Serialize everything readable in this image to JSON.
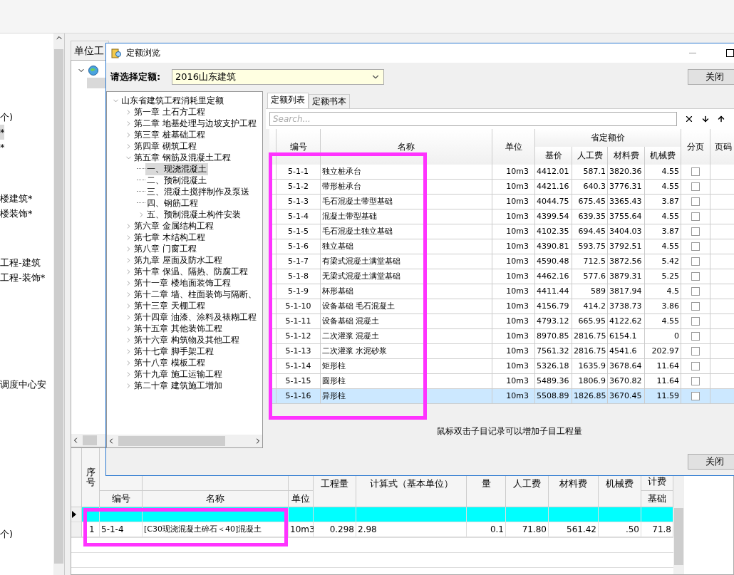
{
  "left_panel": {
    "groups": [
      {
        "items": [
          {
            "label": "个)",
            "selected": false
          },
          {
            "label": "*",
            "selected": true
          },
          {
            "label": "*",
            "selected": false
          }
        ]
      },
      {
        "items": [
          {
            "label": "楼建筑*",
            "selected": false
          },
          {
            "label": "楼装饰*",
            "selected": false
          }
        ]
      },
      {
        "items": [
          {
            "label": "工程-建筑",
            "selected": false
          },
          {
            "label": "工程-装饰*",
            "selected": false
          }
        ]
      },
      {
        "items": [
          {
            "label": "调度中心安",
            "selected": false
          }
        ]
      },
      {
        "items": [
          {
            "label": "个)",
            "selected": false
          }
        ]
      }
    ]
  },
  "unit_panel": {
    "tab": "单位工"
  },
  "bottom_grid": {
    "columns": [
      {
        "label": "序号",
        "kind": "vertical"
      },
      {
        "label": "编号",
        "kind": "sub"
      },
      {
        "label": "名称",
        "kind": "sub"
      },
      {
        "label": "单位",
        "kind": "sub"
      },
      {
        "label": "工程量",
        "kind": "tall"
      },
      {
        "label": "计算式（基本单位）",
        "kind": "tall"
      },
      {
        "label": "量",
        "kind": "tall"
      },
      {
        "label": "人工费",
        "kind": "tall"
      },
      {
        "label": "材料费",
        "kind": "tall"
      },
      {
        "label": "机械费",
        "kind": "tall"
      },
      {
        "label": "基础",
        "group": "计费",
        "kind": "grouped"
      }
    ],
    "rows": [
      {
        "kind": "blank",
        "current": true
      },
      {
        "kind": "data",
        "current": false,
        "cells": [
          "1",
          "5-1-4",
          "[C30现浇混凝土碎石＜40]混凝土",
          "10m3",
          "0.298",
          "2.98",
          "0.1",
          "71.80",
          "561.42",
          ".50",
          "71.8"
        ]
      }
    ]
  },
  "dialog": {
    "title": "定额浏览",
    "select_label": "请选择定额:",
    "select_value": "2016山东建筑",
    "close_button": "关闭",
    "bottom_close_button": "关闭",
    "tree": [
      {
        "label": "山东省建筑工程消耗里定额",
        "expandable": true,
        "expanded": true,
        "selected": false,
        "children": [
          {
            "label": "第一章 土石方工程",
            "expandable": true,
            "expanded": false,
            "selected": false
          },
          {
            "label": "第二章 地基处理与边坡支护工程",
            "expandable": true,
            "expanded": false,
            "selected": false
          },
          {
            "label": "第三章 桩基础工程",
            "expandable": true,
            "expanded": false,
            "selected": false
          },
          {
            "label": "第四章 砌筑工程",
            "expandable": true,
            "expanded": false,
            "selected": false
          },
          {
            "label": "第五章 钢筋及混凝土工程",
            "expandable": true,
            "expanded": true,
            "selected": false,
            "children": [
              {
                "label": "一、现浇混凝土",
                "expandable": false,
                "selected": true
              },
              {
                "label": "二、预制混凝土",
                "expandable": false,
                "selected": false
              },
              {
                "label": "三、混凝土搅拌制作及泵送",
                "expandable": false,
                "selected": false
              },
              {
                "label": "四、钢筋工程",
                "expandable": false,
                "selected": false
              },
              {
                "label": "五、预制混凝土构件安装",
                "expandable": true,
                "expanded": false,
                "selected": false
              }
            ]
          },
          {
            "label": "第六章 金属结构工程",
            "expandable": true,
            "expanded": false,
            "selected": false
          },
          {
            "label": "第七章 木结构工程",
            "expandable": true,
            "expanded": false,
            "selected": false
          },
          {
            "label": "第八章 门窗工程",
            "expandable": true,
            "expanded": false,
            "selected": false
          },
          {
            "label": "第九章 屋面及防水工程",
            "expandable": true,
            "expanded": false,
            "selected": false
          },
          {
            "label": "第十章 保温、隔热、防腐工程",
            "expandable": true,
            "expanded": false,
            "selected": false
          },
          {
            "label": "第十一章 楼地面装饰工程",
            "expandable": true,
            "expanded": false,
            "selected": false
          },
          {
            "label": "第十二章 墙、柱面装饰与隔断、",
            "expandable": true,
            "expanded": false,
            "selected": false
          },
          {
            "label": "第十三章 天棚工程",
            "expandable": true,
            "expanded": false,
            "selected": false
          },
          {
            "label": "第十四章 油漆、涂料及裱糊工程",
            "expandable": true,
            "expanded": false,
            "selected": false
          },
          {
            "label": "第十五章 其他装饰工程",
            "expandable": true,
            "expanded": false,
            "selected": false
          },
          {
            "label": "第十六章 构筑物及其他工程",
            "expandable": true,
            "expanded": false,
            "selected": false
          },
          {
            "label": "第十七章 脚手架工程",
            "expandable": true,
            "expanded": false,
            "selected": false
          },
          {
            "label": "第十八章 模板工程",
            "expandable": true,
            "expanded": false,
            "selected": false
          },
          {
            "label": "第十九章 施工运输工程",
            "expandable": true,
            "expanded": false,
            "selected": false
          },
          {
            "label": "第二十章 建筑施工增加",
            "expandable": true,
            "expanded": false,
            "selected": false
          }
        ]
      }
    ],
    "tabs": [
      {
        "label": "定额列表",
        "selected": true
      },
      {
        "label": "定额书本",
        "selected": false
      }
    ],
    "search": {
      "placeholder": "Search..."
    },
    "table": {
      "columns": [
        {
          "label": "编号"
        },
        {
          "label": "名称"
        },
        {
          "label": "单位"
        },
        {
          "group": "省定额价",
          "children": [
            "基价",
            "人工费",
            "材料费",
            "机械费"
          ]
        },
        {
          "label": "分页"
        },
        {
          "label": "页码"
        }
      ],
      "rows": [
        {
          "code": "5-1-1",
          "name": "独立桩承台",
          "unit": "10m3",
          "base": "4412.01",
          "labor": "587.1",
          "material": "3820.36",
          "machine": "4.55",
          "paged": false,
          "selected": false
        },
        {
          "code": "5-1-2",
          "name": "带形桩承台",
          "unit": "10m3",
          "base": "4421.16",
          "labor": "640.3",
          "material": "3776.31",
          "machine": "4.55",
          "paged": false,
          "selected": false
        },
        {
          "code": "5-1-3",
          "name": "毛石混凝土带型基础",
          "unit": "10m3",
          "base": "4044.75",
          "labor": "675.45",
          "material": "3365.43",
          "machine": "3.87",
          "paged": false,
          "selected": false
        },
        {
          "code": "5-1-4",
          "name": "混凝土带型基础",
          "unit": "10m3",
          "base": "4399.54",
          "labor": "639.35",
          "material": "3755.64",
          "machine": "4.55",
          "paged": false,
          "selected": false
        },
        {
          "code": "5-1-5",
          "name": "毛石混凝土独立基础",
          "unit": "10m3",
          "base": "4102.35",
          "labor": "694.45",
          "material": "3404.03",
          "machine": "3.87",
          "paged": false,
          "selected": false
        },
        {
          "code": "5-1-6",
          "name": "独立基础",
          "unit": "10m3",
          "base": "4390.81",
          "labor": "593.75",
          "material": "3792.51",
          "machine": "4.55",
          "paged": false,
          "selected": false
        },
        {
          "code": "5-1-7",
          "name": "有梁式混凝土满堂基础",
          "unit": "10m3",
          "base": "4590.48",
          "labor": "712.5",
          "material": "3872.56",
          "machine": "5.42",
          "paged": false,
          "selected": false
        },
        {
          "code": "5-1-8",
          "name": "无梁式混凝土满堂基础",
          "unit": "10m3",
          "base": "4462.16",
          "labor": "577.6",
          "material": "3879.31",
          "machine": "5.25",
          "paged": false,
          "selected": false
        },
        {
          "code": "5-1-9",
          "name": "杯形基础",
          "unit": "10m3",
          "base": "4411.44",
          "labor": "589",
          "material": "3817.94",
          "machine": "4.5",
          "paged": false,
          "selected": false
        },
        {
          "code": "5-1-10",
          "name": "设备基础 毛石混凝土",
          "unit": "10m3",
          "base": "4156.79",
          "labor": "414.2",
          "material": "3738.73",
          "machine": "3.86",
          "paged": false,
          "selected": false
        },
        {
          "code": "5-1-11",
          "name": "设备基础 混凝土",
          "unit": "10m3",
          "base": "4793.12",
          "labor": "665.95",
          "material": "4122.62",
          "machine": "4.55",
          "paged": false,
          "selected": false
        },
        {
          "code": "5-1-12",
          "name": "二次灌浆 混凝土",
          "unit": "10m3",
          "base": "8970.85",
          "labor": "2816.75",
          "material": "6154.1",
          "machine": "0",
          "paged": false,
          "selected": false
        },
        {
          "code": "5-1-13",
          "name": "二次灌浆 水泥砂浆",
          "unit": "10m3",
          "base": "7561.32",
          "labor": "2816.75",
          "material": "4541.6",
          "machine": "202.97",
          "paged": false,
          "selected": false
        },
        {
          "code": "5-1-14",
          "name": "矩形柱",
          "unit": "10m3",
          "base": "5326.18",
          "labor": "1635.9",
          "material": "3678.64",
          "machine": "11.64",
          "paged": false,
          "selected": false
        },
        {
          "code": "5-1-15",
          "name": "圆形柱",
          "unit": "10m3",
          "base": "5489.36",
          "labor": "1806.9",
          "material": "3670.82",
          "machine": "11.64",
          "paged": false,
          "selected": false
        },
        {
          "code": "5-1-16",
          "name": "异形柱",
          "unit": "10m3",
          "base": "5508.89",
          "labor": "1826.85",
          "material": "3670.45",
          "machine": "11.59",
          "paged": false,
          "selected": true
        }
      ]
    },
    "hint": "鼠标双击子目记录可以增加子目工程量"
  },
  "markup_frames": [
    {
      "kind": "rectangle"
    },
    {
      "kind": "rectangle"
    }
  ]
}
